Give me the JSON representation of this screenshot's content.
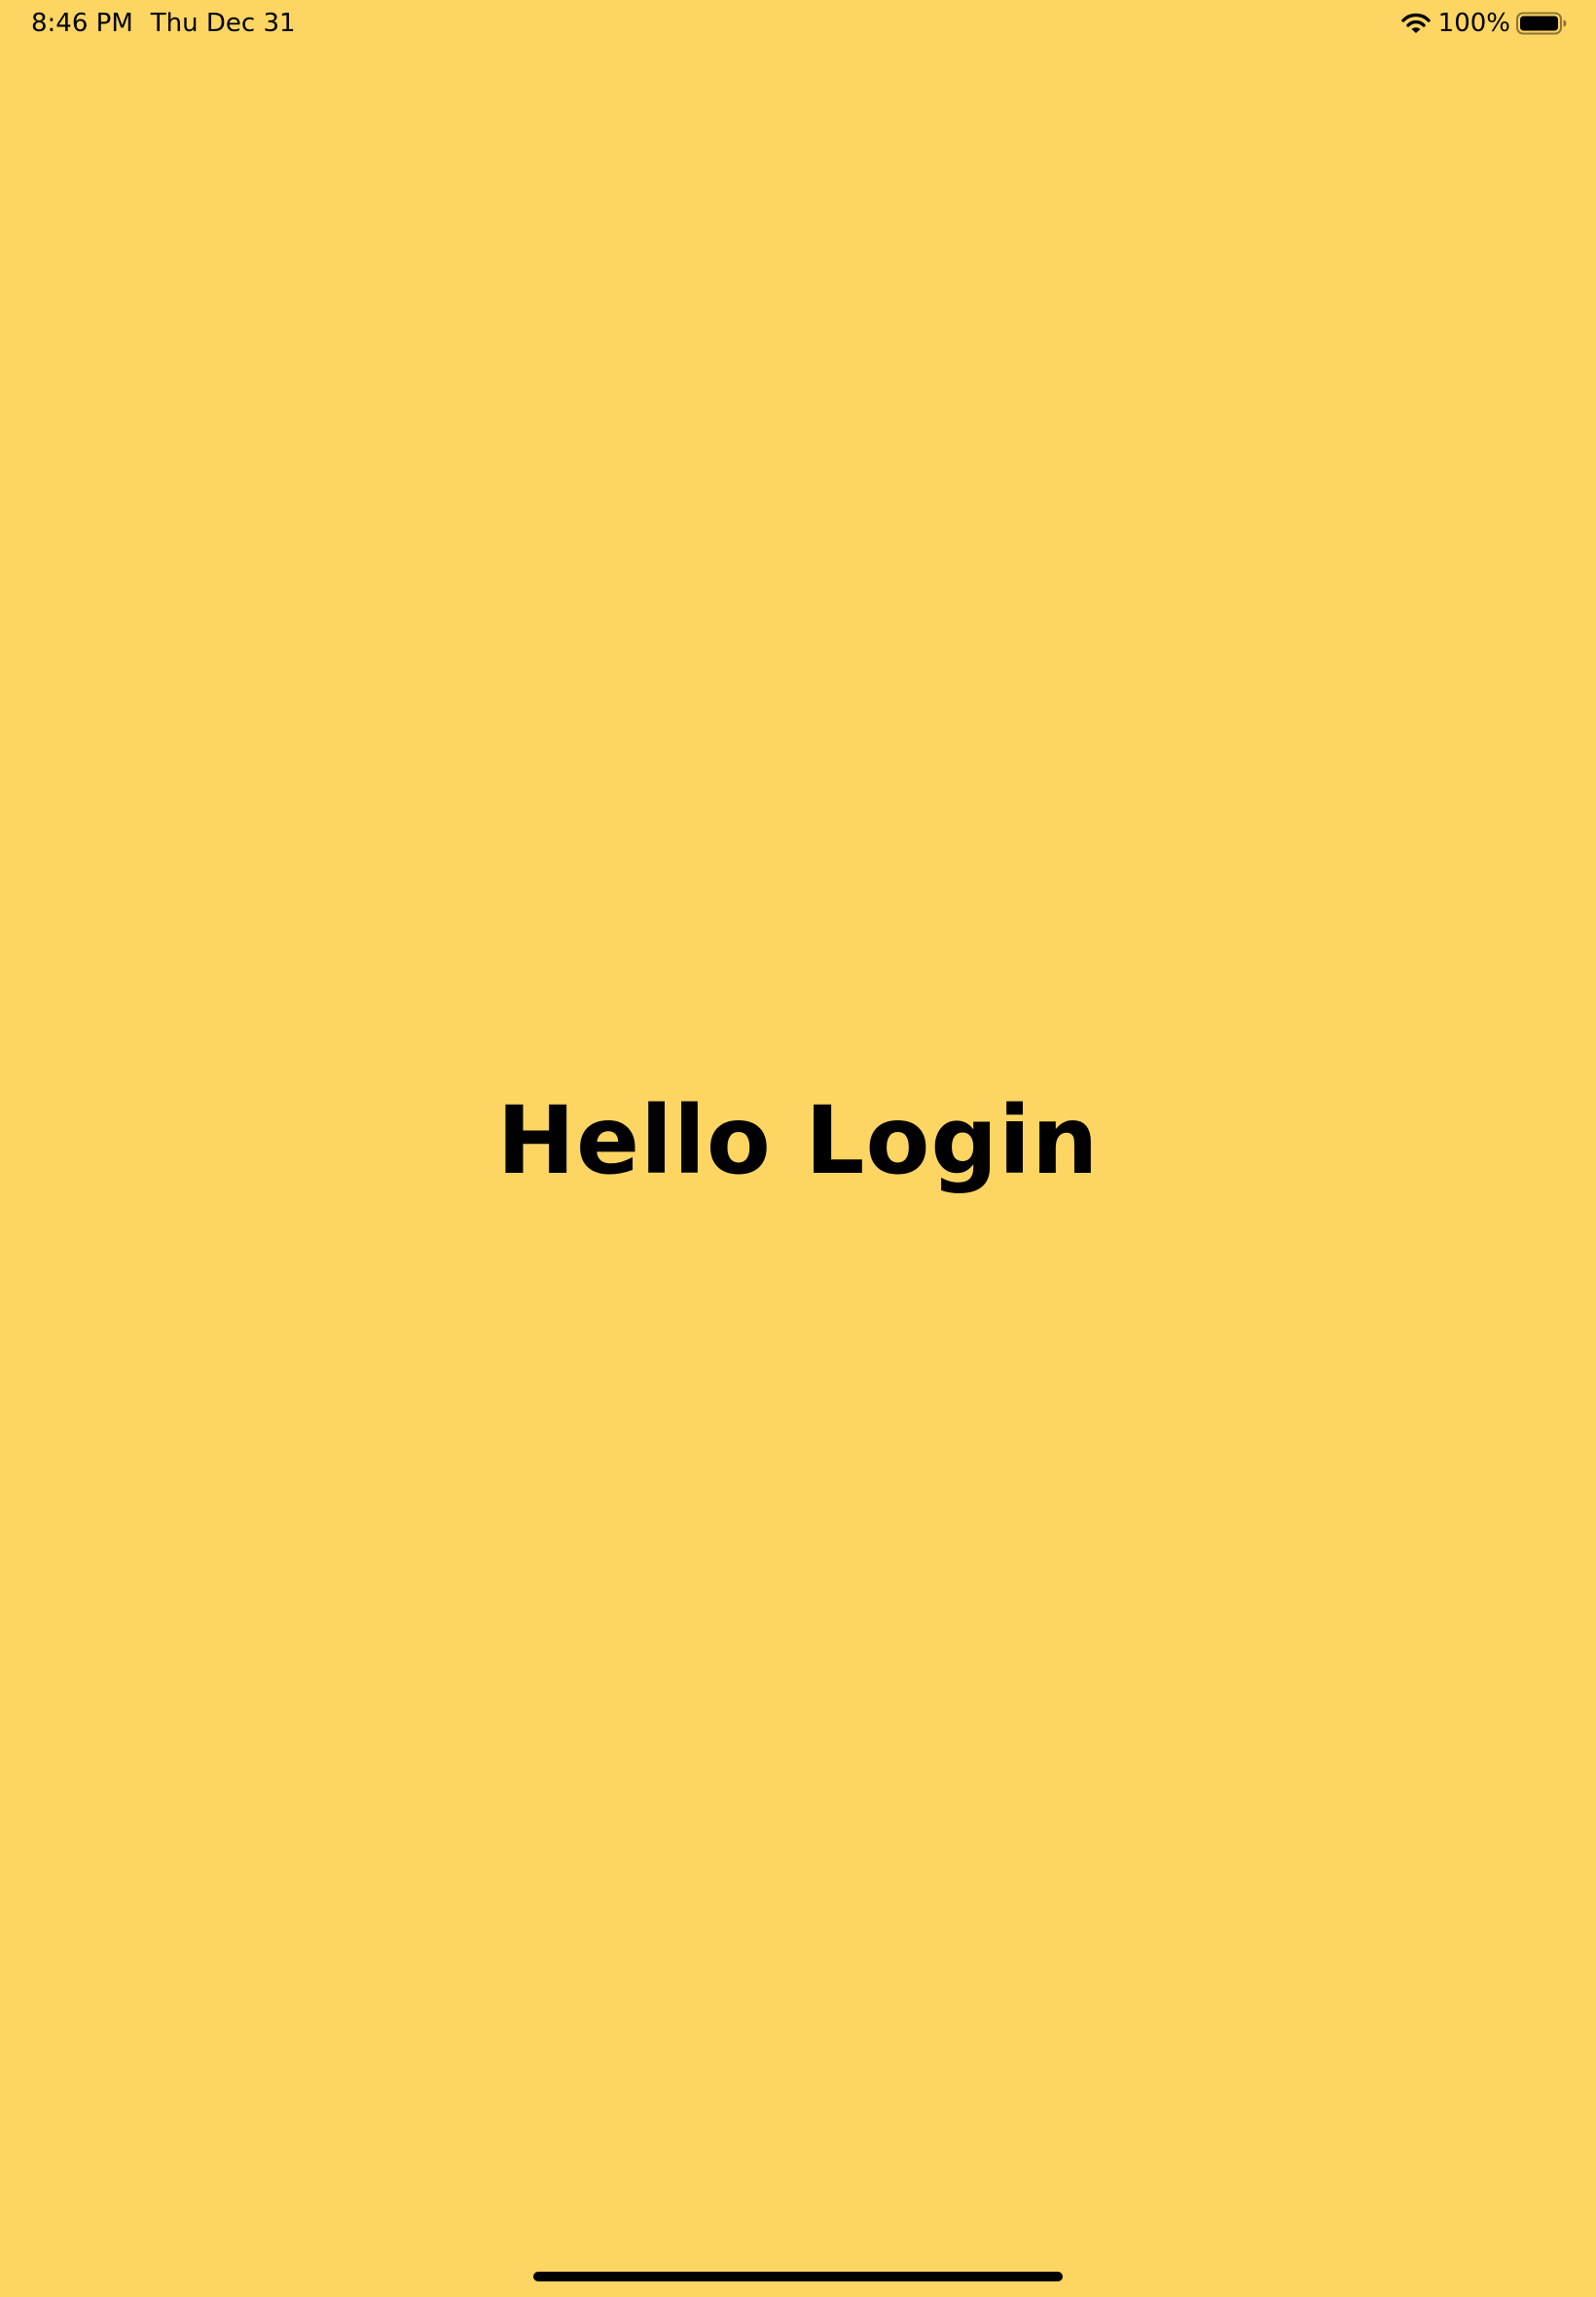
{
  "status_bar": {
    "time": "8:46 PM",
    "date": "Thu Dec 31",
    "battery_percent": "100%",
    "wifi_icon": "wifi-icon",
    "battery_icon": "battery-full-icon"
  },
  "main": {
    "title": "Hello Login"
  },
  "colors": {
    "background": "#FCD562",
    "text": "#000000"
  }
}
